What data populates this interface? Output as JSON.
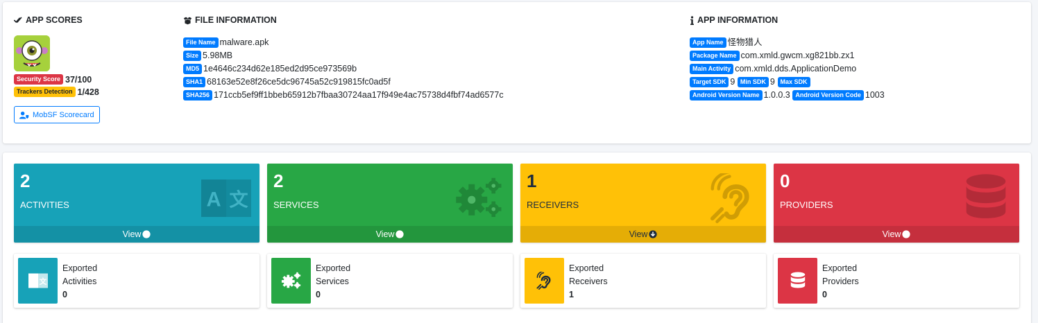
{
  "top": {
    "scores": {
      "title": "APP SCORES",
      "security_label": "Security Score",
      "security_value": "37/100",
      "trackers_label": "Trackers Detection",
      "trackers_value": "1/428",
      "scorecard_button": "MobSF Scorecard"
    },
    "file_info": {
      "title": "FILE INFORMATION",
      "rows": [
        {
          "label": "File Name",
          "value": "malware.apk"
        },
        {
          "label": "Size",
          "value": "5.98MB"
        },
        {
          "label": "MD5",
          "value": "1e4646c234d62e185ed2d95ce973569b"
        },
        {
          "label": "SHA1",
          "value": "68163e52e8f26ce5dc96745a52c919815fc0ad5f"
        },
        {
          "label": "SHA256",
          "value": "171ccb5ef9ff1bbeb65912b7fbaa30724aa17f949e4ac75738d4fbf74ad6577c"
        }
      ]
    },
    "app_info": {
      "title": "APP INFORMATION",
      "app_name_label": "App Name",
      "app_name": "怪物猎人",
      "package_label": "Package Name",
      "package": "com.xmld.gwcm.xg821bb.zx1",
      "main_activity_label": "Main Activity",
      "main_activity": "com.xmld.dds.ApplicationDemo",
      "target_sdk_label": "Target SDK",
      "target_sdk": "9",
      "min_sdk_label": "Min SDK",
      "min_sdk": "9",
      "max_sdk_label": "Max SDK",
      "max_sdk": "",
      "version_name_label": "Android Version Name",
      "version_name": "1.0.0.3",
      "version_code_label": "Android Version Code",
      "version_code": "1003"
    }
  },
  "tiles": [
    {
      "count": "2",
      "label": "ACTIVITIES",
      "view": "View",
      "color": "#17a2b8",
      "icon": "language-icon"
    },
    {
      "count": "2",
      "label": "SERVICES",
      "view": "View",
      "color": "#28a745",
      "icon": "cogs-icon"
    },
    {
      "count": "1",
      "label": "RECEIVERS",
      "view": "View",
      "color": "#ffc107",
      "icon": "hearing-icon"
    },
    {
      "count": "0",
      "label": "PROVIDERS",
      "view": "View",
      "color": "#dc3545",
      "icon": "database-icon"
    }
  ],
  "exported": [
    {
      "line1": "Exported",
      "line2": "Activities",
      "count": "0"
    },
    {
      "line1": "Exported",
      "line2": "Services",
      "count": "0"
    },
    {
      "line1": "Exported",
      "line2": "Receivers",
      "count": "1"
    },
    {
      "line1": "Exported",
      "line2": "Providers",
      "count": "0"
    }
  ]
}
